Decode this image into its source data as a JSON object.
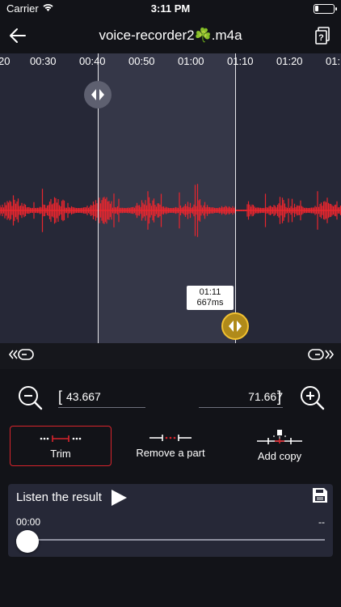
{
  "status": {
    "carrier": "Carrier",
    "time": "3:11 PM"
  },
  "nav": {
    "title": "voice-recorder2☘️.m4a",
    "back_icon": "arrow-left-icon",
    "help_icon": "help-document-icon"
  },
  "timeline": {
    "labels": [
      "20",
      "00:30",
      "00:40",
      "00:50",
      "01:00",
      "01:10",
      "01:20",
      "01:"
    ]
  },
  "selection": {
    "tooltip_time": "01:11",
    "tooltip_ms": "667ms"
  },
  "range": {
    "start_value": "43.667",
    "end_value": "71.667",
    "open_bracket": "[",
    "close_bracket": "]"
  },
  "modes": [
    {
      "label": "Trim",
      "selected": true
    },
    {
      "label": "Remove a part",
      "selected": false
    },
    {
      "label": "Add copy",
      "selected": false
    }
  ],
  "listen": {
    "title": "Listen the result",
    "current_time": "00:00",
    "total_time": "--",
    "progress": 0
  },
  "colors": {
    "accent_red": "#d8242c",
    "handle_active": "#f2c232",
    "waveform": "#e8262e",
    "selection_bg": "#353748",
    "panel_bg": "#262837"
  }
}
